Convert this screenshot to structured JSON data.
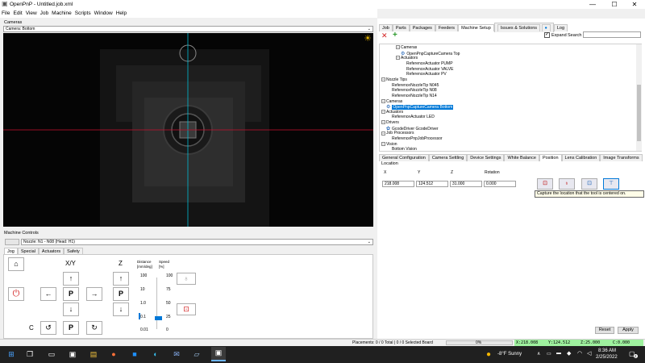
{
  "window": {
    "title": "OpenPnP - Untitled.job.xml",
    "min": "—",
    "max": "☐",
    "close": "✕"
  },
  "menu": [
    "File",
    "Edit",
    "View",
    "Job",
    "Machine",
    "Scripts",
    "Window",
    "Help"
  ],
  "cameras": {
    "section": "Cameras",
    "selected_camera": "Camera: Bottom"
  },
  "machine_controls": {
    "section": "Machine Controls",
    "nozzle": "Nozzle: N1 - N08 (Head: H1)",
    "tabs": [
      "Jog",
      "Special",
      "Actuators",
      "Safety"
    ],
    "xy_label": "X/Y",
    "z_label": "Z",
    "c_label": "C",
    "park": "P",
    "arrows": {
      "up": "↑",
      "down": "↓",
      "left": "←",
      "right": "→",
      "rot_ccw": "↺",
      "rot_cw": "↻"
    },
    "distance_label": "Distance",
    "distance_unit": "[mm/deg]",
    "distance_ticks": [
      "100",
      "10",
      "1.0",
      "0.1",
      "0.01"
    ],
    "distance_value": 0.1,
    "speed_label": "Speed",
    "speed_unit": "[%]",
    "speed_ticks": [
      "100",
      "75",
      "50",
      "25",
      "0"
    ],
    "speed_value": 25
  },
  "right_tabs": [
    "Job",
    "Parts",
    "Packages",
    "Feeders",
    "Machine Setup",
    "Issues & Solutions",
    "Log"
  ],
  "toolbar": {
    "expand_label": "Expand",
    "expand_checked": true,
    "search_label": "Search",
    "search_value": ""
  },
  "tree": [
    {
      "label": "Cameras",
      "depth": 3,
      "type": "folder"
    },
    {
      "label": "OpenPnpCaptureCamera Top",
      "depth": 4,
      "type": "camera"
    },
    {
      "label": "Actuators",
      "depth": 3,
      "type": "folder"
    },
    {
      "label": "ReferenceActuator PUMP",
      "depth": 4,
      "type": "item"
    },
    {
      "label": "ReferenceActuator VALVE",
      "depth": 4,
      "type": "item"
    },
    {
      "label": "ReferenceActuator PV",
      "depth": 4,
      "type": "item"
    },
    {
      "label": "Nozzle Tips",
      "depth": 0,
      "type": "folder"
    },
    {
      "label": "ReferenceNozzleTip N045",
      "depth": 1,
      "type": "item"
    },
    {
      "label": "ReferenceNozzleTip N08",
      "depth": 1,
      "type": "item"
    },
    {
      "label": "ReferenceNozzleTip N14",
      "depth": 1,
      "type": "item"
    },
    {
      "label": "Cameras",
      "depth": 0,
      "type": "folder"
    },
    {
      "label": "OpenPnpCaptureCamera Bottom",
      "depth": 1,
      "type": "camera",
      "selected": true
    },
    {
      "label": "Actuators",
      "depth": 0,
      "type": "folder"
    },
    {
      "label": "ReferenceActuator LED",
      "depth": 1,
      "type": "item"
    },
    {
      "label": "Drivers",
      "depth": 0,
      "type": "folder"
    },
    {
      "label": "GcodeDriver GcodeDriver",
      "depth": 1,
      "type": "driver"
    },
    {
      "label": "Job Processors",
      "depth": 0,
      "type": "folder"
    },
    {
      "label": "ReferencePnpJobProcessor",
      "depth": 1,
      "type": "item"
    },
    {
      "label": "Vision",
      "depth": 0,
      "type": "folder"
    },
    {
      "label": "Bottom Vision",
      "depth": 1,
      "type": "item"
    }
  ],
  "config_tabs": [
    "General Configuration",
    "Camera Settling",
    "Device Settings",
    "White Balance",
    "Position",
    "Lens Calibration",
    "Image Transforms"
  ],
  "position": {
    "section": "Location",
    "headers": [
      "X",
      "Y",
      "Z",
      "Rotation"
    ],
    "values": [
      "218.008",
      "124.512",
      "31.000",
      "0.000"
    ],
    "tooltip": "Capture the location that the tool is centered on."
  },
  "buttons": {
    "reset": "Reset",
    "apply": "Apply"
  },
  "status": {
    "placements": "Placements: 0 / 0 Total | 0 / 0 Selected Board",
    "progress": "0%",
    "progress_value": 0,
    "x": "X:218.008",
    "y": "Y:124.512",
    "z": "Z:25.000",
    "c": "C:0.000"
  },
  "taskbar": {
    "weather": "-8°F  Sunny",
    "time": "8:36 AM",
    "date": "2/25/2022",
    "notifications": "2"
  },
  "colors": {
    "accent": "#0078d7",
    "crosshair_red": "#c8102e",
    "crosshair_cyan": "#00bcd4",
    "coords_green": "#9ff29f",
    "power_red": "#d21f1f"
  }
}
